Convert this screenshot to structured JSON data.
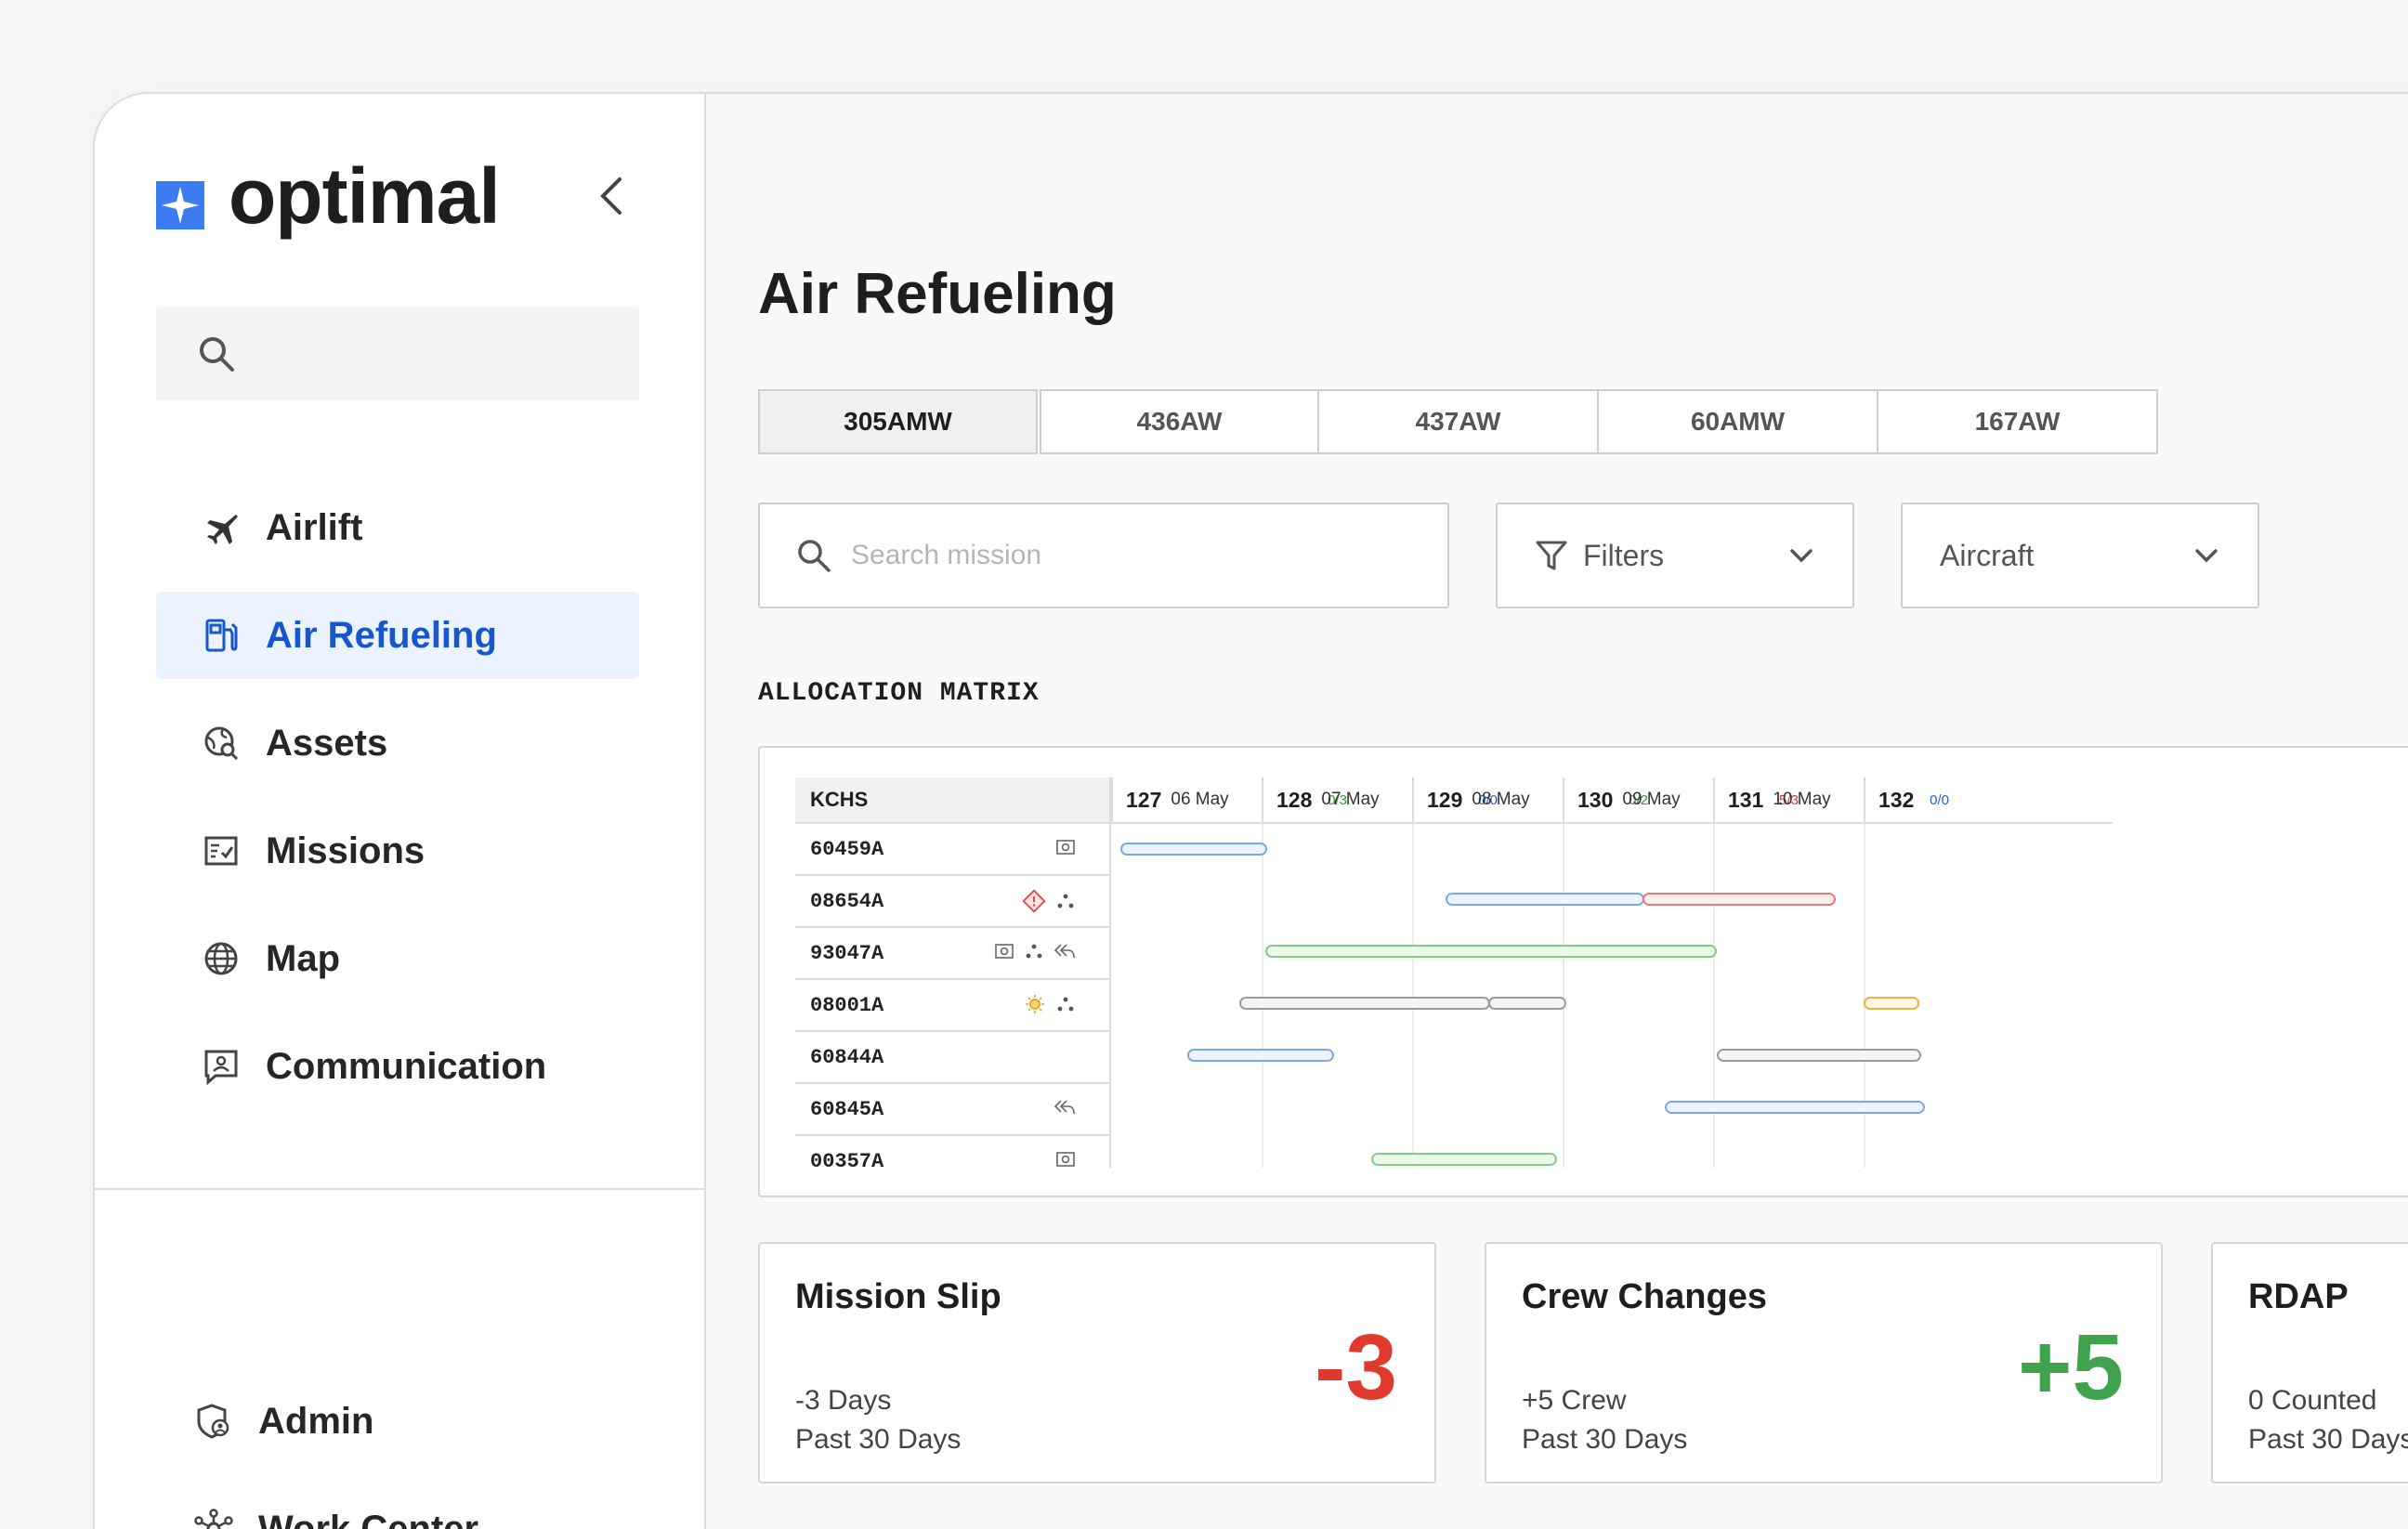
{
  "brand": {
    "name": "optimal",
    "accent": "#3b7df0"
  },
  "sidebar": {
    "search_placeholder": "",
    "items": [
      {
        "label": "Airlift",
        "icon": "airplane-icon"
      },
      {
        "label": "Air Refueling",
        "icon": "fuel-pump-icon",
        "active": true
      },
      {
        "label": "Assets",
        "icon": "globe-search-icon"
      },
      {
        "label": "Missions",
        "icon": "checklist-icon"
      },
      {
        "label": "Map",
        "icon": "globe-icon"
      },
      {
        "label": "Communication",
        "icon": "contact-card-icon"
      }
    ],
    "bottom_items": [
      {
        "label": "Admin",
        "icon": "shield-user-icon"
      },
      {
        "label": "Work Center",
        "icon": "network-hub-icon"
      }
    ]
  },
  "main": {
    "title": "Air Refueling",
    "tabs": [
      "305AMW",
      "436AW",
      "437AW",
      "60AMW",
      "167AW"
    ],
    "active_tab": "305AMW",
    "search": {
      "placeholder": "Search mission"
    },
    "filters_label": "Filters",
    "aircraft_label": "Aircraft",
    "matrix_title": "ALLOCATION MATRIX"
  },
  "matrix": {
    "base": "KCHS",
    "days": [
      {
        "num": "127",
        "date": "06 May",
        "ratio": "0/3",
        "ratio_color": "#2e9b2e"
      },
      {
        "num": "128",
        "date": "07 May",
        "ratio": "0/0",
        "ratio_color": "#2b5fc0"
      },
      {
        "num": "129",
        "date": "08 May",
        "ratio": "0/2",
        "ratio_color": "#2e9b2e"
      },
      {
        "num": "130",
        "date": "09 May",
        "ratio": "5/3",
        "ratio_color": "#d33b3b"
      },
      {
        "num": "131",
        "date": "10 May",
        "ratio": "0/0",
        "ratio_color": "#2b5fc0"
      },
      {
        "num": "132",
        "date": "",
        "ratio": "",
        "ratio_color": "#2b5fc0"
      }
    ],
    "rows": [
      {
        "tail": "60459A",
        "icons": [
          "camera-icon"
        ]
      },
      {
        "tail": "08654A",
        "icons": [
          "alert-diamond-icon",
          "dots-cluster-icon"
        ]
      },
      {
        "tail": "93047A",
        "icons": [
          "camera-icon",
          "dots-cluster-icon",
          "reply-all-icon"
        ]
      },
      {
        "tail": "08001A",
        "icons": [
          "sun-icon",
          "dots-cluster-icon"
        ]
      },
      {
        "tail": "60844A",
        "icons": []
      },
      {
        "tail": "60845A",
        "icons": [
          "reply-all-icon"
        ]
      },
      {
        "tail": "00357A",
        "icons": [
          "camera-icon"
        ]
      }
    ]
  },
  "cards": [
    {
      "title": "Mission Slip",
      "line1": "-3 Days",
      "line2": "Past 30 Days",
      "value": "-3",
      "value_color": "#e03a2f"
    },
    {
      "title": "Crew Changes",
      "line1": "+5 Crew",
      "line2": "Past 30 Days",
      "value": "+5",
      "value_color": "#3fa34d"
    },
    {
      "title": "RDAP",
      "line1": "0 Counted",
      "line2": "Past 30 Days",
      "value": "",
      "value_color": "#1e1e1e"
    }
  ]
}
